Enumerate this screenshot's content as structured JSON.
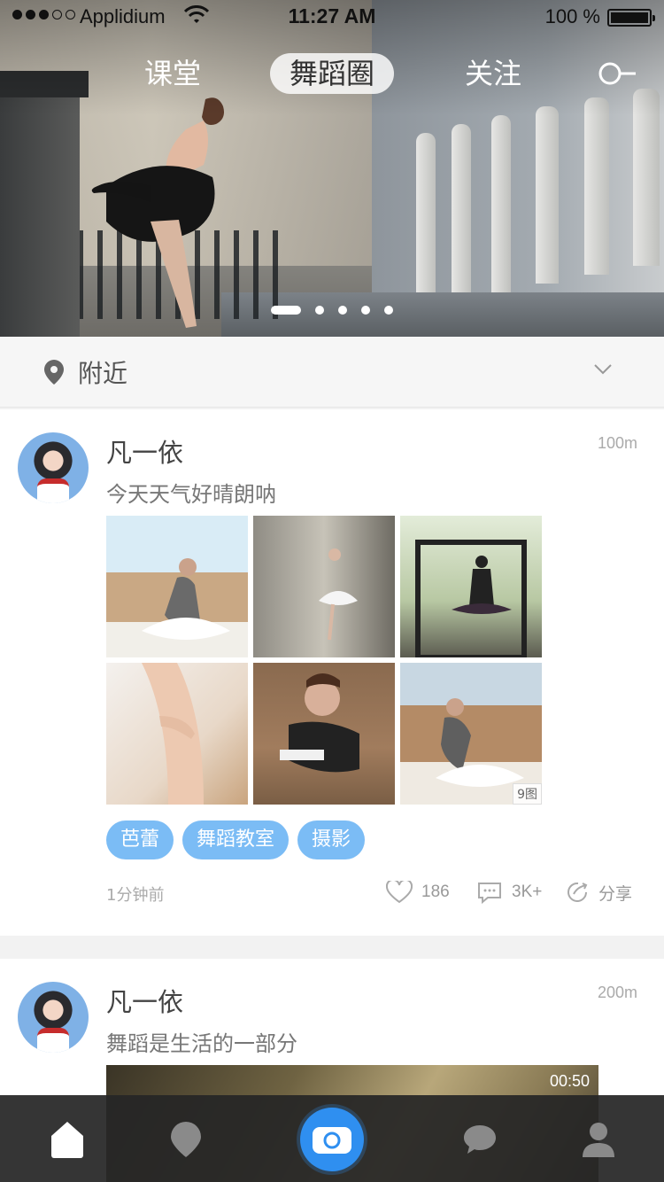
{
  "status_bar": {
    "carrier": "Applidium",
    "time": "11:27 AM",
    "battery": "100 %"
  },
  "top_tabs": [
    {
      "label": "课堂",
      "active": false
    },
    {
      "label": "舞蹈圈",
      "active": true
    },
    {
      "label": "关注",
      "active": false
    }
  ],
  "hero": {
    "slide_count": 5,
    "active_slide": 1
  },
  "location_filter": {
    "label": "附近",
    "icon": "location-pin-icon"
  },
  "posts": [
    {
      "username": "凡一依",
      "distance": "100m",
      "caption": "今天天气好晴朗呐",
      "image_count_badge": "9图",
      "tags": [
        "芭蕾",
        "舞蹈教室",
        "摄影"
      ],
      "time_ago": "1分钟前",
      "likes": "186",
      "comments": "3K+",
      "share_label": "分享"
    },
    {
      "username": "凡一依",
      "distance": "200m",
      "caption": "舞蹈是生活的一部分",
      "video_duration": "00:50"
    }
  ],
  "tab_bar": {
    "items": [
      "home-icon",
      "map-pin-icon",
      "camera-icon",
      "chat-icon",
      "profile-icon"
    ],
    "accent": "#2f8ff0"
  },
  "colors": {
    "tag_bg": "#7bbcf5",
    "tab_bar_bg": "#262626"
  }
}
